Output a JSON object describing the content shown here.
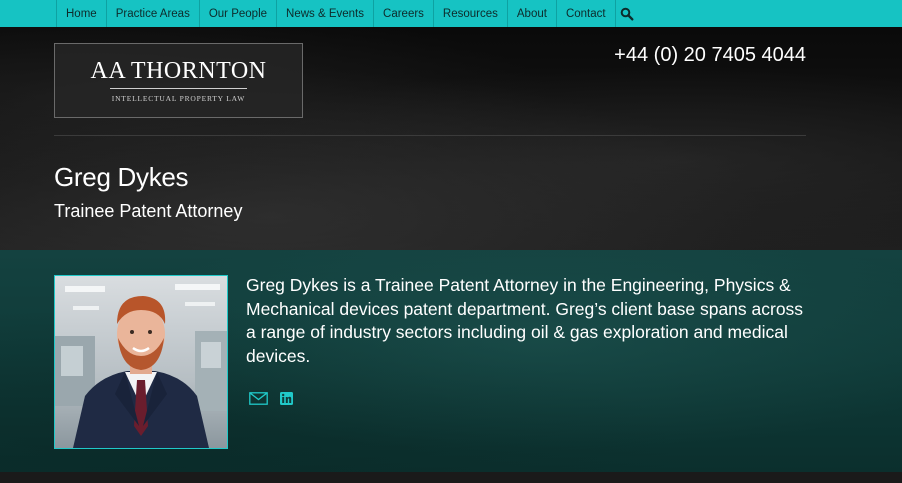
{
  "nav": {
    "items": [
      {
        "label": "Home"
      },
      {
        "label": "Practice Areas"
      },
      {
        "label": "Our People"
      },
      {
        "label": "News & Events"
      },
      {
        "label": "Careers"
      },
      {
        "label": "Resources"
      },
      {
        "label": "About"
      },
      {
        "label": "Contact"
      }
    ],
    "search_icon": "search-icon"
  },
  "header": {
    "logo_name": "AA THORNTON",
    "logo_tagline": "INTELLECTUAL PROPERTY LAW",
    "phone": "+44 (0) 20 7405 4044"
  },
  "person": {
    "name": "Greg Dykes",
    "title": "Trainee Patent Attorney",
    "bio": "Greg Dykes is a Trainee Patent Attorney in the Engineering, Physics & Mechanical devices patent department. Greg’s client base spans across a range of industry sectors including oil & gas exploration and medical devices.",
    "contact_icons": [
      "email-icon",
      "linkedin-icon"
    ]
  },
  "colors": {
    "nav_background": "#16c3c3",
    "accent": "#20c9c9",
    "profile_band": "#0f3a38"
  }
}
